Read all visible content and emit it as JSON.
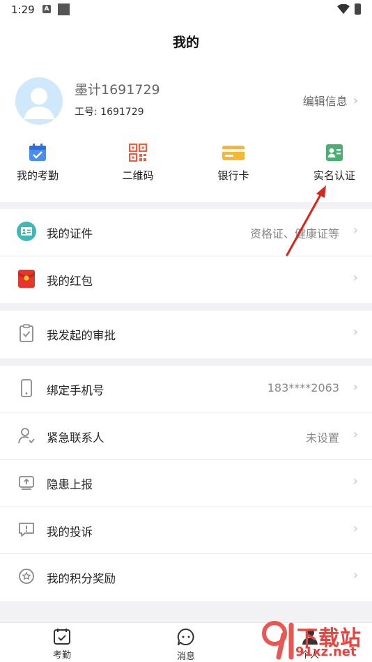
{
  "status_bar": {
    "time": "1:29",
    "a_badge": "A"
  },
  "header": {
    "title": "我的"
  },
  "profile": {
    "name": "墨计1691729",
    "employee_id": "工号: 1691729",
    "edit_label": "编辑信息"
  },
  "shortcuts": [
    {
      "label": "我的考勤",
      "icon": "calendar-check-icon",
      "color": "#4a8ef0"
    },
    {
      "label": "二维码",
      "icon": "qr-code-icon",
      "color": "#f25a3c"
    },
    {
      "label": "银行卡",
      "icon": "bank-card-icon",
      "color": "#f7b731"
    },
    {
      "label": "实名认证",
      "icon": "id-card-icon",
      "color": "#4caf72"
    }
  ],
  "group1": [
    {
      "label": "我的证件",
      "value": "资格证、健康证等",
      "icon": "certificate-icon"
    },
    {
      "label": "我的红包",
      "value": "",
      "icon": "red-envelope-icon"
    }
  ],
  "group2": [
    {
      "label": "我发起的审批",
      "value": "",
      "icon": "clipboard-check-icon"
    }
  ],
  "group3": [
    {
      "label": "绑定手机号",
      "value": "183****2063",
      "icon": "phone-icon"
    },
    {
      "label": "紧急联系人",
      "value": "未设置",
      "icon": "contact-icon"
    },
    {
      "label": "隐患上报",
      "value": "",
      "icon": "report-upload-icon"
    },
    {
      "label": "我的投诉",
      "value": "",
      "icon": "complaint-icon"
    },
    {
      "label": "我的积分奖励",
      "value": "",
      "icon": "points-reward-icon"
    }
  ],
  "tabbar": [
    {
      "label": "考勤",
      "icon": "attendance-icon"
    },
    {
      "label": "消息",
      "icon": "message-icon"
    },
    {
      "label": "个人",
      "icon": "person-icon"
    }
  ],
  "watermark": {
    "text": "下载站",
    "url": "91xz.net"
  },
  "chevron": "›"
}
